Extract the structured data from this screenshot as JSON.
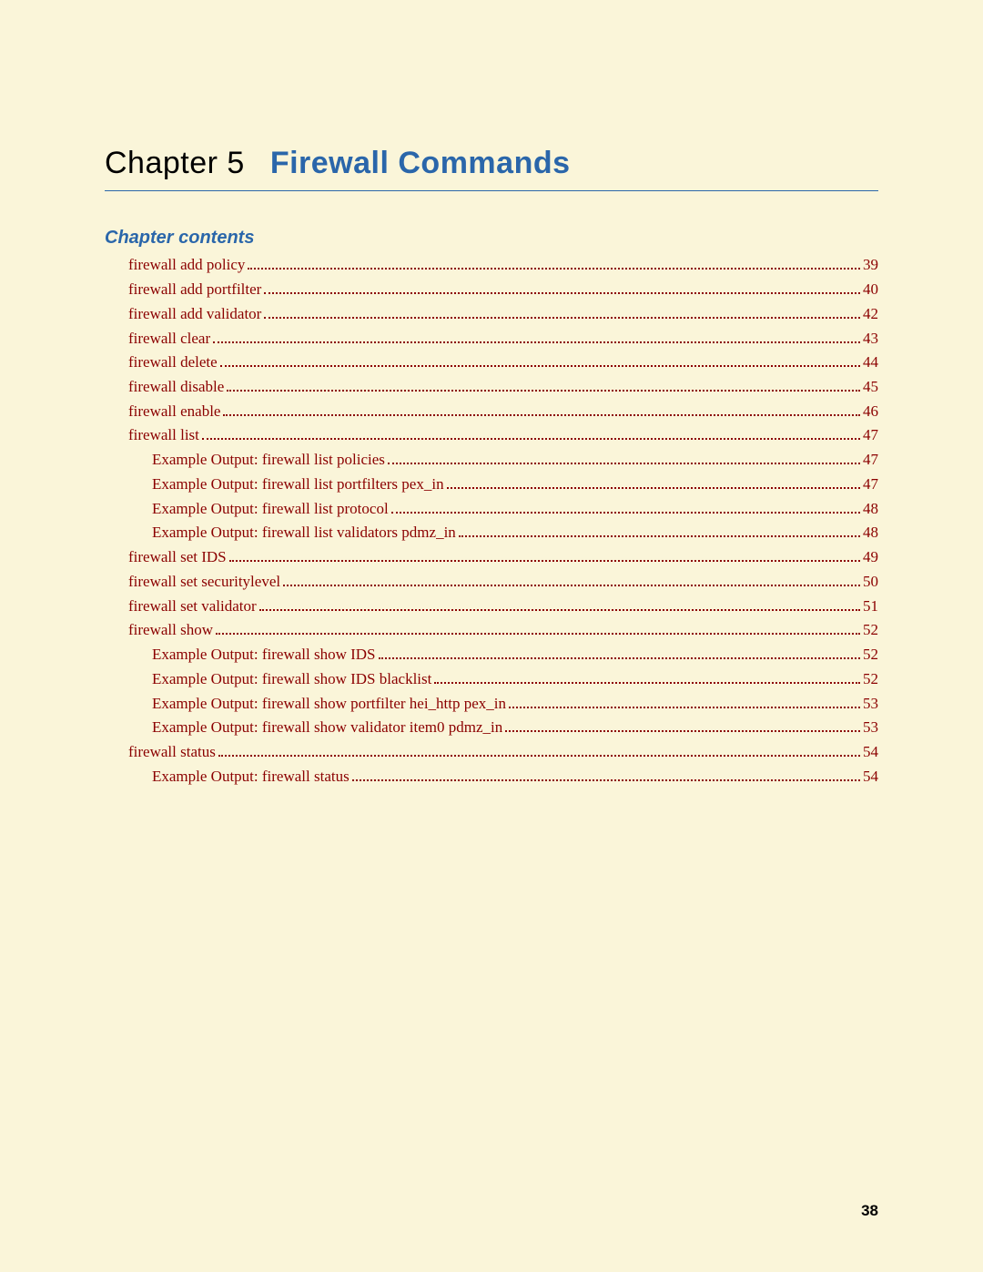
{
  "chapter": {
    "label": "Chapter 5",
    "title": "Firewall Commands"
  },
  "section_heading": "Chapter contents",
  "toc": [
    {
      "level": 1,
      "label": "firewall add policy",
      "page": "39"
    },
    {
      "level": 1,
      "label": "firewall add portfilter",
      "page": "40"
    },
    {
      "level": 1,
      "label": "firewall add validator",
      "page": "42"
    },
    {
      "level": 1,
      "label": "firewall clear",
      "page": "43"
    },
    {
      "level": 1,
      "label": "firewall delete",
      "page": "44"
    },
    {
      "level": 1,
      "label": "firewall disable",
      "page": "45"
    },
    {
      "level": 1,
      "label": "firewall enable",
      "page": "46"
    },
    {
      "level": 1,
      "label": "firewall list",
      "page": "47"
    },
    {
      "level": 2,
      "label": "Example Output: firewall list policies",
      "page": "47"
    },
    {
      "level": 2,
      "label": "Example Output: firewall list portfilters pex_in",
      "page": "47"
    },
    {
      "level": 2,
      "label": "Example Output: firewall list protocol",
      "page": "48"
    },
    {
      "level": 2,
      "label": "Example Output: firewall list validators pdmz_in",
      "page": "48"
    },
    {
      "level": 1,
      "label": "firewall set IDS",
      "page": "49"
    },
    {
      "level": 1,
      "label": "firewall set securitylevel",
      "page": "50"
    },
    {
      "level": 1,
      "label": "firewall set validator",
      "page": "51"
    },
    {
      "level": 1,
      "label": "firewall show",
      "page": "52"
    },
    {
      "level": 2,
      "label": "Example Output: firewall show IDS",
      "page": "52"
    },
    {
      "level": 2,
      "label": "Example Output: firewall show IDS blacklist",
      "page": "52"
    },
    {
      "level": 2,
      "label": "Example Output: firewall show portfilter hei_http pex_in",
      "page": "53"
    },
    {
      "level": 2,
      "label": "Example Output: firewall show validator item0 pdmz_in",
      "page": "53"
    },
    {
      "level": 1,
      "label": "firewall status",
      "page": "54"
    },
    {
      "level": 2,
      "label": "Example Output: firewall status",
      "page": "54"
    }
  ],
  "page_number": "38"
}
